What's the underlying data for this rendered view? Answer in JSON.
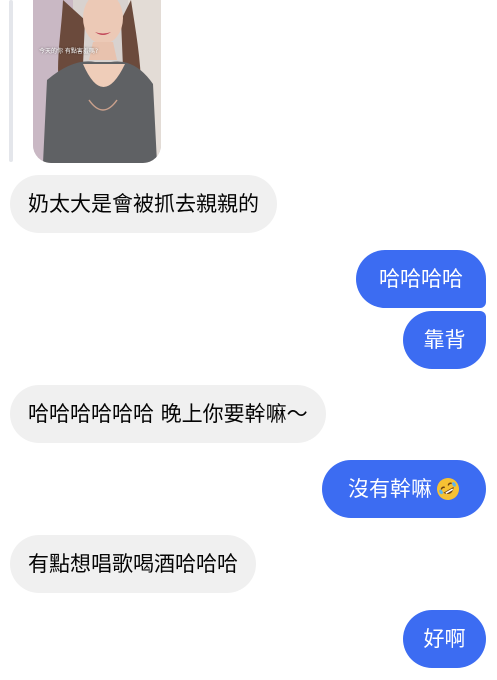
{
  "conversation": {
    "shared_media": {
      "caption": "今天的你 有點害羞嗎?"
    },
    "messages": [
      {
        "side": "incoming",
        "text": "奶太大是會被抓去親親的"
      },
      {
        "side": "outgoing",
        "text": "哈哈哈哈"
      },
      {
        "side": "outgoing",
        "text": "靠背"
      },
      {
        "side": "incoming",
        "text": "哈哈哈哈哈哈 晚上你要幹嘛～"
      },
      {
        "side": "outgoing",
        "text": "沒有幹嘛",
        "emoji": "rolling-on-floor-laughing-emoji"
      },
      {
        "side": "incoming",
        "text": "有點想唱歌喝酒哈哈哈"
      },
      {
        "side": "outgoing",
        "text": "好啊"
      }
    ]
  },
  "colors": {
    "outgoing_bubble": "#3c6cf2",
    "incoming_bubble": "#f0f0f0",
    "reply_bar": "#e4e6eb"
  }
}
